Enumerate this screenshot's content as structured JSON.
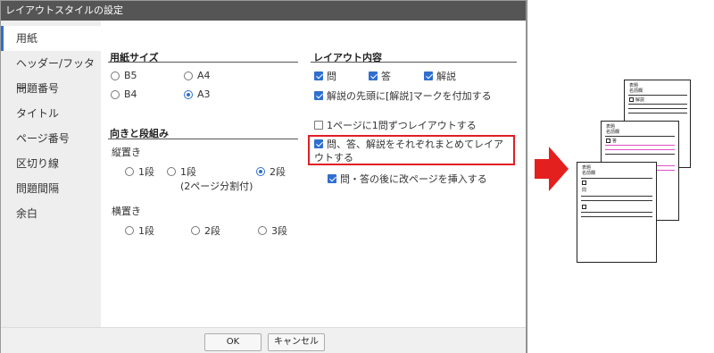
{
  "dialog": {
    "title": "レイアウトスタイルの設定"
  },
  "sidebar": {
    "items": [
      {
        "label": "用紙"
      },
      {
        "label": "ヘッダー/フッター"
      },
      {
        "label": "問題番号"
      },
      {
        "label": "タイトル"
      },
      {
        "label": "ページ番号"
      },
      {
        "label": "区切り線"
      },
      {
        "label": "問題間隔"
      },
      {
        "label": "余白"
      }
    ],
    "selected": "用紙"
  },
  "paper_size": {
    "title": "用紙サイズ",
    "options": [
      {
        "label": "B5",
        "checked": false
      },
      {
        "label": "A4",
        "checked": false
      },
      {
        "label": "B4",
        "checked": false
      },
      {
        "label": "A3",
        "checked": true
      }
    ]
  },
  "orientation": {
    "title": "向きと段組み",
    "portrait": {
      "label": "縦置き",
      "options": [
        {
          "label": "1段",
          "checked": false
        },
        {
          "label": "1段",
          "checked": false
        },
        {
          "label": "2段",
          "checked": true
        }
      ],
      "note": "(2ページ分割付)"
    },
    "landscape": {
      "label": "横置き",
      "options": [
        {
          "label": "1段",
          "checked": false
        },
        {
          "label": "2段",
          "checked": false
        },
        {
          "label": "3段",
          "checked": false
        }
      ]
    }
  },
  "layout_content": {
    "title": "レイアウト内容",
    "items": [
      {
        "label": "問",
        "checked": true
      },
      {
        "label": "答",
        "checked": true
      },
      {
        "label": "解説",
        "checked": true
      }
    ],
    "mark_option": {
      "label": "解説の先頭に[解説]マークを付加する",
      "checked": true
    },
    "one_per_page": {
      "label": "1ページに1問ずつレイアウトする",
      "checked": false
    },
    "group_option": {
      "label": "問、答、解説をそれぞれまとめてレイアウトする",
      "checked": true
    },
    "page_break": {
      "label": "問・答の後に改ページを挿入する",
      "checked": true
    }
  },
  "footer": {
    "ok_label": "OK",
    "cancel_label": "キャンセル"
  },
  "preview": {
    "pages": [
      {
        "header": [
          "表題",
          "名前欄"
        ],
        "item": "解説"
      },
      {
        "header": [
          "表題",
          "名前欄"
        ],
        "item": "答"
      },
      {
        "header": [
          "表題",
          "名前欄"
        ],
        "item": "問"
      }
    ]
  },
  "colors": {
    "accent": "#2f6fd0",
    "highlight": "#e01e25",
    "title_bar": "#555555",
    "pink_line": "#e050c8"
  }
}
